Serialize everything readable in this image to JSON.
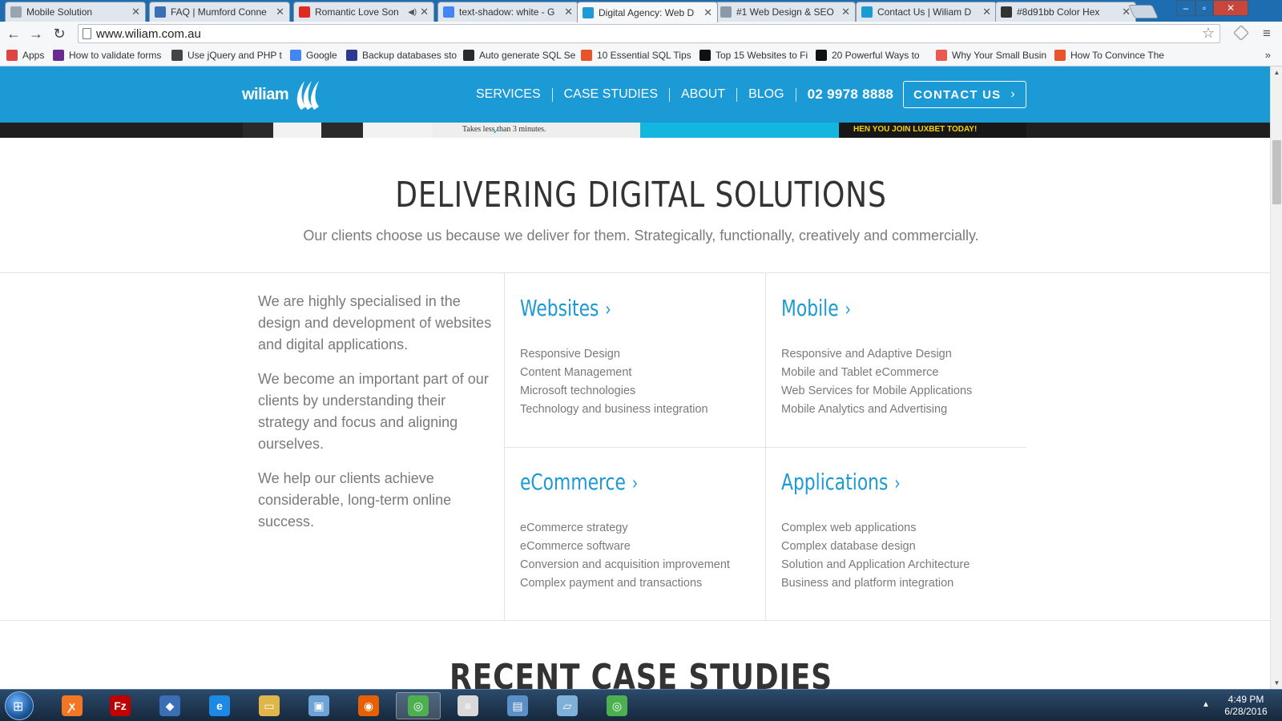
{
  "browser": {
    "tabs": [
      {
        "title": "Mobile Solution",
        "icon": "page-icon",
        "icon_color": "#9aa4ae",
        "active": false
      },
      {
        "title": "FAQ | Mumford Conne",
        "icon": "site-icon",
        "icon_color": "#3a6fb5",
        "active": false
      },
      {
        "title": "Romantic Love Son",
        "icon": "youtube-icon",
        "icon_color": "#e02a20",
        "active": false,
        "sound": true
      },
      {
        "title": "text-shadow: white - G",
        "icon": "google-icon",
        "icon_color": "#4285f4",
        "active": false
      },
      {
        "title": "Digital Agency: Web D",
        "icon": "wiliam-icon",
        "icon_color": "#1b9ad6",
        "active": true
      },
      {
        "title": "#1 Web Design & SEO",
        "icon": "globe-icon",
        "icon_color": "#8a98a8",
        "active": false
      },
      {
        "title": "Contact Us | Wiliam D",
        "icon": "wiliam-icon",
        "icon_color": "#1b9ad6",
        "active": false
      },
      {
        "title": "#8d91bb Color Hex",
        "icon": "pen-icon",
        "icon_color": "#333333",
        "active": false
      }
    ],
    "url": "www.wiliam.com.au",
    "bookmarks": [
      {
        "label": "Apps",
        "icon": "apps-icon",
        "icon_color": "#d44"
      },
      {
        "label": "How to validate forms",
        "icon": "site-icon",
        "icon_color": "#6a2b8f"
      },
      {
        "label": "Use jQuery and PHP t",
        "icon": "site-icon",
        "icon_color": "#444"
      },
      {
        "label": "Google",
        "icon": "google-icon",
        "icon_color": "#4285f4"
      },
      {
        "label": "Backup databases sto",
        "icon": "site-icon",
        "icon_color": "#2b3a8f"
      },
      {
        "label": "Auto generate SQL Se",
        "icon": "site-icon",
        "icon_color": "#2a2a2a"
      },
      {
        "label": "10 Essential SQL Tips",
        "icon": "plus-icon",
        "icon_color": "#e8532b"
      },
      {
        "label": "Top 15 Websites to Fi",
        "icon": "site-icon",
        "icon_color": "#111"
      },
      {
        "label": "20 Powerful Ways to",
        "icon": "site-icon",
        "icon_color": "#111"
      },
      {
        "label": "Why Your Small Busin",
        "icon": "diamond-icon",
        "icon_color": "#e85a4f"
      },
      {
        "label": "How To Convince The",
        "icon": "site-icon",
        "icon_color": "#e8532b"
      }
    ]
  },
  "site": {
    "logo_text": "wiliam",
    "nav": [
      "SERVICES",
      "CASE STUDIES",
      "ABOUT",
      "BLOG"
    ],
    "phone": "02 9978 8888",
    "contact_label": "CONTACT US",
    "brand_color": "#1b9ad6",
    "carousel": {
      "slide2_text": "Takes less than 3 minutes.",
      "slide4_text": "HEN YOU JOIN LUXBET TODAY!"
    },
    "intro": {
      "title": "DELIVERING DIGITAL SOLUTIONS",
      "subtitle": "Our clients choose us because we deliver for them. Strategically, functionally, creatively and commercially."
    },
    "about": [
      "We are highly specialised in the design and development of websites and digital applications.",
      "We become an important part of our clients by understanding their strategy and focus and aligning ourselves.",
      "We help our clients achieve considerable, long-term online success."
    ],
    "services": [
      {
        "title": "Websites",
        "items": [
          "Responsive Design",
          "Content Management",
          "Microsoft technologies",
          "Technology and business integration"
        ]
      },
      {
        "title": "Mobile",
        "items": [
          "Responsive and Adaptive Design",
          "Mobile and Tablet eCommerce",
          "Web Services for Mobile Applications",
          "Mobile Analytics and Advertising"
        ]
      },
      {
        "title": "eCommerce",
        "items": [
          "eCommerce strategy",
          "eCommerce software",
          "Conversion and acquisition improvement",
          "Complex payment and transactions"
        ]
      },
      {
        "title": "Applications",
        "items": [
          "Complex web applications",
          "Complex database design",
          "Solution and Application Architecture",
          "Business and platform integration"
        ]
      }
    ],
    "recent_title": "RECENT CASE STUDIES"
  },
  "taskbar": {
    "apps": [
      {
        "name": "xampp-icon",
        "color": "#f37623",
        "glyph": "ꭗ",
        "active": false
      },
      {
        "name": "filezilla-icon",
        "color": "#bf0000",
        "glyph": "Fz",
        "active": false
      },
      {
        "name": "mysql-workbench-icon",
        "color": "#3a6fb5",
        "glyph": "◆",
        "active": false
      },
      {
        "name": "internet-explorer-icon",
        "color": "#1e88e5",
        "glyph": "e",
        "active": false
      },
      {
        "name": "file-explorer-icon",
        "color": "#e0b64a",
        "glyph": "▭",
        "active": false
      },
      {
        "name": "virtualbox-icon",
        "color": "#6ea3d8",
        "glyph": "▣",
        "active": false
      },
      {
        "name": "firefox-icon",
        "color": "#e66000",
        "glyph": "◉",
        "active": false
      },
      {
        "name": "chrome-icon",
        "color": "#4caf50",
        "glyph": "◎",
        "active": true
      },
      {
        "name": "notepad-icon",
        "color": "#d9d9d9",
        "glyph": "≡",
        "active": false
      },
      {
        "name": "screenshot-icon",
        "color": "#5b8fc7",
        "glyph": "▤",
        "active": false
      },
      {
        "name": "notes-icon",
        "color": "#7fb0d8",
        "glyph": "▱",
        "active": false
      },
      {
        "name": "chrome-icon",
        "color": "#4caf50",
        "glyph": "◎",
        "active": false
      }
    ],
    "time": "4:49 PM",
    "date": "6/28/2016"
  }
}
